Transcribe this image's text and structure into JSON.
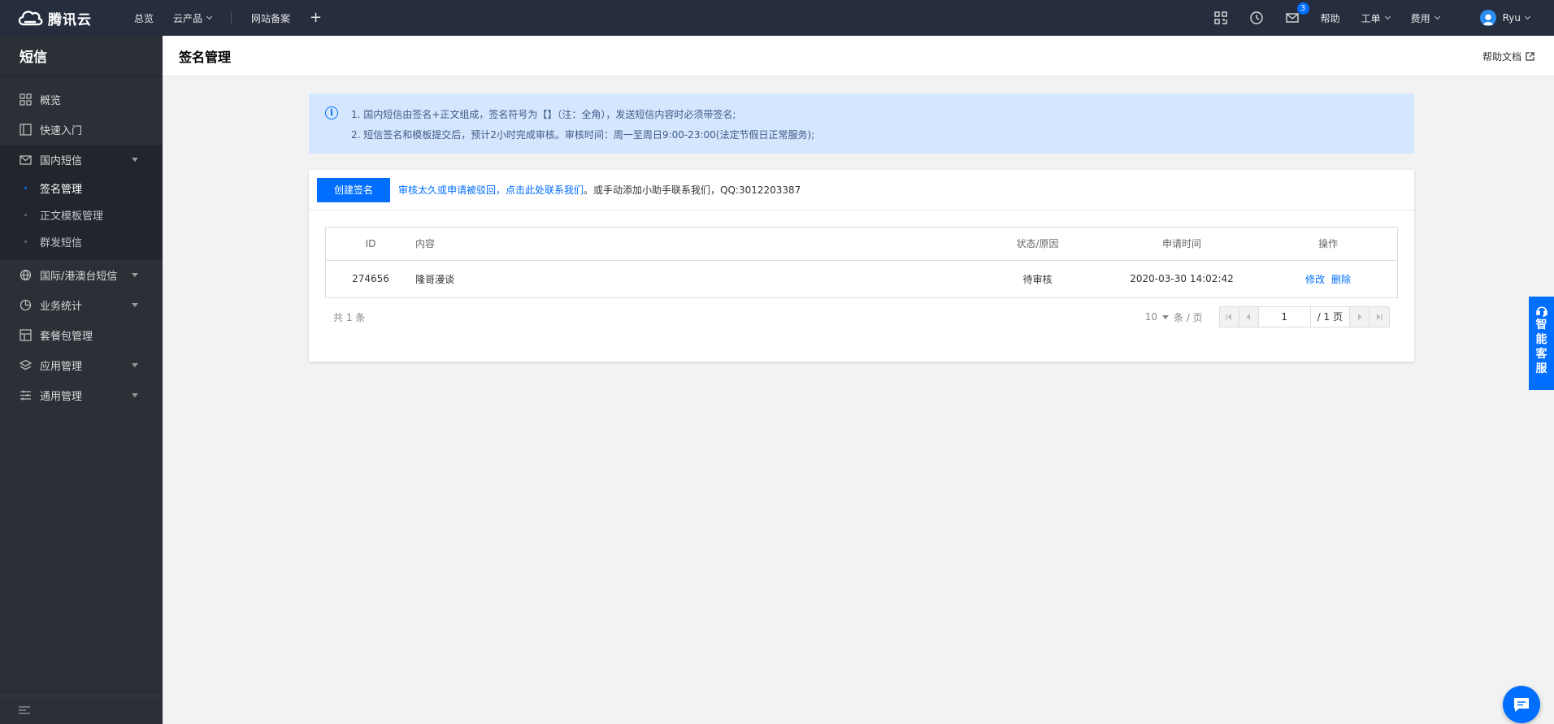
{
  "topbar": {
    "brand": "腾讯云",
    "nav": {
      "overview": "总览",
      "products": "云产品",
      "icp": "网站备案",
      "add": "+"
    },
    "right": {
      "message_count": "3",
      "help": "帮助",
      "tickets": "工单",
      "billing": "费用",
      "user": "Ryu"
    }
  },
  "sidebar": {
    "title": "短信",
    "items": [
      {
        "label": "概览",
        "icon": "grid-icon"
      },
      {
        "label": "快速入门",
        "icon": "book-icon"
      },
      {
        "label": "国内短信",
        "icon": "mail-icon"
      },
      {
        "label": "国际/港澳台短信",
        "icon": "globe-icon"
      },
      {
        "label": "业务统计",
        "icon": "chart-icon"
      },
      {
        "label": "套餐包管理",
        "icon": "package-icon"
      },
      {
        "label": "应用管理",
        "icon": "layers-icon"
      },
      {
        "label": "通用管理",
        "icon": "sliders-icon"
      }
    ],
    "sub_items": [
      "签名管理",
      "正文模板管理",
      "群发短信"
    ]
  },
  "page": {
    "title": "签名管理",
    "help_doc": "帮助文档"
  },
  "notice": {
    "line1": "1. 国内短信由签名+正文组成，签名符号为【】（注：全角），发送短信内容时必须带签名;",
    "line2": "2. 短信签名和模板提交后，预计2小时完成审核。审核时间：周一至周日9:00-23:00(法定节假日正常服务);"
  },
  "toolbar": {
    "create_label": "创建签名",
    "link_text": "审核太久或申请被驳回，点击此处联系我们",
    "plain_text": "。或手动添加小助手联系我们，QQ:3012203387"
  },
  "table": {
    "headers": {
      "id": "ID",
      "content": "内容",
      "status": "状态/原因",
      "time": "申请时间",
      "ops": "操作"
    },
    "rows": [
      {
        "id": "274656",
        "content": "隆哥漫谈",
        "status": "待审核",
        "time": "2020-03-30 14:02:42",
        "edit": "修改",
        "delete": "删除"
      }
    ]
  },
  "footer": {
    "total": "共 1 条",
    "page_size": "10",
    "per_page": "条 / 页",
    "current_page": "1",
    "total_pages": "/ 1 页"
  },
  "float": {
    "service_chars": [
      "智",
      "能",
      "客",
      "服"
    ]
  },
  "colors": {
    "primary": "#006eff",
    "topbar": "#262e3e",
    "sidebar": "#2b2f36",
    "notice_bg": "#d5e7ff"
  }
}
